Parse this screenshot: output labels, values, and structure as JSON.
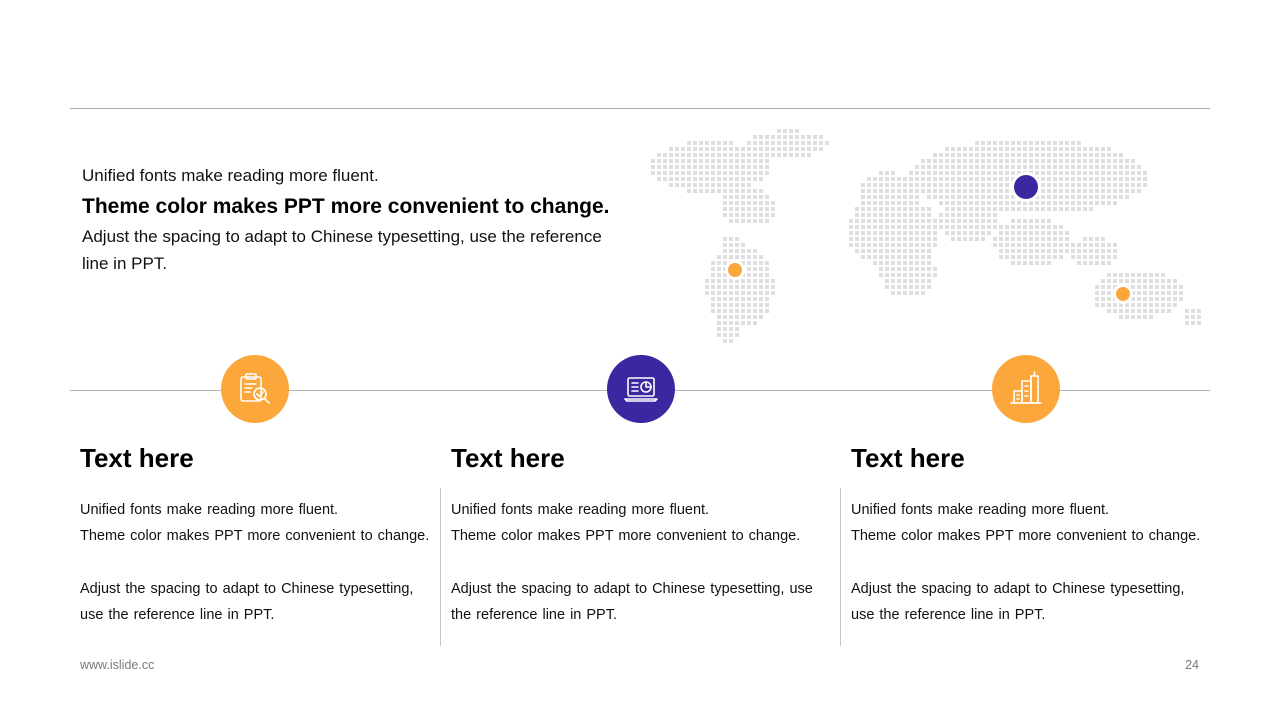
{
  "intro": {
    "line1": "Unified fonts make reading more fluent.",
    "line2": "Theme color makes PPT more convenient to change.",
    "line3": "Adjust the spacing to adapt to Chinese typesetting, use the reference line in PPT."
  },
  "colors": {
    "orange": "#FBA73B",
    "purple": "#3B27A0",
    "map_dots": "#DEDEDE",
    "rule": "#B3B3B3"
  },
  "map": {
    "markers": [
      {
        "name": "asia-marker",
        "color": "#3B27A0"
      },
      {
        "name": "south-america-marker",
        "color": "#FBA73B"
      },
      {
        "name": "australia-marker",
        "color": "#FBA73B"
      }
    ]
  },
  "columns": [
    {
      "icon": "clipboard-search-icon",
      "icon_color": "#FBA73B",
      "title": "Text here",
      "p1": "Unified fonts make reading more fluent.",
      "p2": "Theme color makes PPT more convenient to change.",
      "p3": "Adjust the spacing to adapt to Chinese typesetting, use the reference line in PPT."
    },
    {
      "icon": "laptop-chart-icon",
      "icon_color": "#3B27A0",
      "title": "Text here",
      "p1": "Unified fonts make reading more fluent.",
      "p2": "Theme color makes PPT more convenient to change.",
      "p3": "Adjust the spacing to adapt to Chinese typesetting, use the reference line in PPT."
    },
    {
      "icon": "city-buildings-icon",
      "icon_color": "#FBA73B",
      "title": "Text here",
      "p1": "Unified fonts make reading more fluent.",
      "p2": "Theme color makes PPT more convenient to change.",
      "p3": "Adjust the spacing to adapt to Chinese typesetting, use the reference line in PPT."
    }
  ],
  "footer": {
    "url": "www.islide.cc",
    "page": "24"
  }
}
